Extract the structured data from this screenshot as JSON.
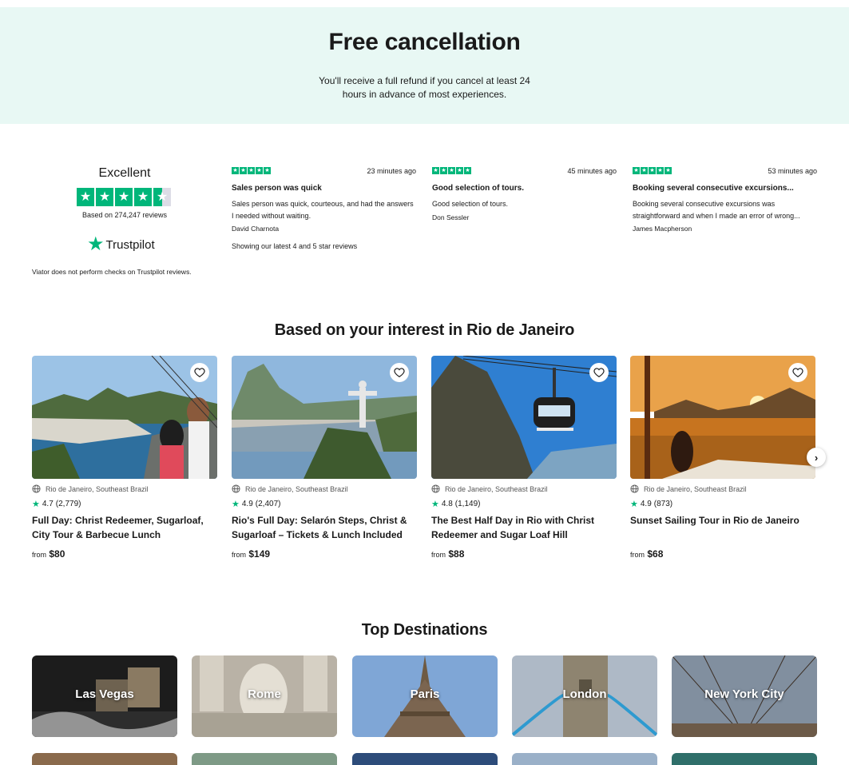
{
  "free_cancellation": {
    "title": "Free cancellation",
    "text": "You'll receive a full refund if you cancel at least 24 hours in advance of most experiences."
  },
  "trustpilot": {
    "rating_word": "Excellent",
    "based_on": "Based on 274,247 reviews",
    "brand": "Trustpilot",
    "disclaimer": "Viator does not perform checks on Trustpilot reviews.",
    "showing_latest": "Showing our latest 4 and 5 star reviews",
    "stars": 4.5,
    "brand_color": "#00b67a"
  },
  "reviews": [
    {
      "time": "23 minutes ago",
      "title": "Sales person was quick",
      "body": "Sales person was quick, courteous, and had the answers I needed without waiting.",
      "author": "David Charnota",
      "stars": 5
    },
    {
      "time": "45 minutes ago",
      "title": "Good selection of tours.",
      "body": "Good selection of tours.",
      "author": "Don Sessler",
      "stars": 5
    },
    {
      "time": "53 minutes ago",
      "title": "Booking several consecutive excursions...",
      "body": "Booking several consecutive excursions was straightforward and when I made an error of wrong...",
      "author": "James Macpherson",
      "stars": 5
    }
  ],
  "interest_section": {
    "title": "Based on your interest in Rio de Janeiro",
    "cards": [
      {
        "location": "Rio de Janeiro, Southeast Brazil",
        "rating": "4.7",
        "count": "(2,779)",
        "title": "Full Day: Christ Redeemer, Sugarloaf, City Tour & Barbecue Lunch",
        "from": "from",
        "price": "$80",
        "icon": "heart-icon"
      },
      {
        "location": "Rio de Janeiro, Southeast Brazil",
        "rating": "4.9",
        "count": "(2,407)",
        "title": "Rio's Full Day: Selarón Steps, Christ & Sugarloaf – Tickets & Lunch Included",
        "from": "from",
        "price": "$149",
        "icon": "heart-icon"
      },
      {
        "location": "Rio de Janeiro, Southeast Brazil",
        "rating": "4.8",
        "count": "(1,149)",
        "title": "The Best Half Day in Rio with Christ Redeemer and Sugar Loaf Hill",
        "from": "from",
        "price": "$88",
        "icon": "heart-icon"
      },
      {
        "location": "Rio de Janeiro, Southeast Brazil",
        "rating": "4.9",
        "count": "(873)",
        "title": "Sunset Sailing Tour in Rio de Janeiro",
        "from": "from",
        "price": "$68",
        "icon": "heart-icon"
      }
    ]
  },
  "destinations": {
    "title": "Top Destinations",
    "items": [
      "Las Vegas",
      "Rome",
      "Paris",
      "London",
      "New York City"
    ]
  }
}
